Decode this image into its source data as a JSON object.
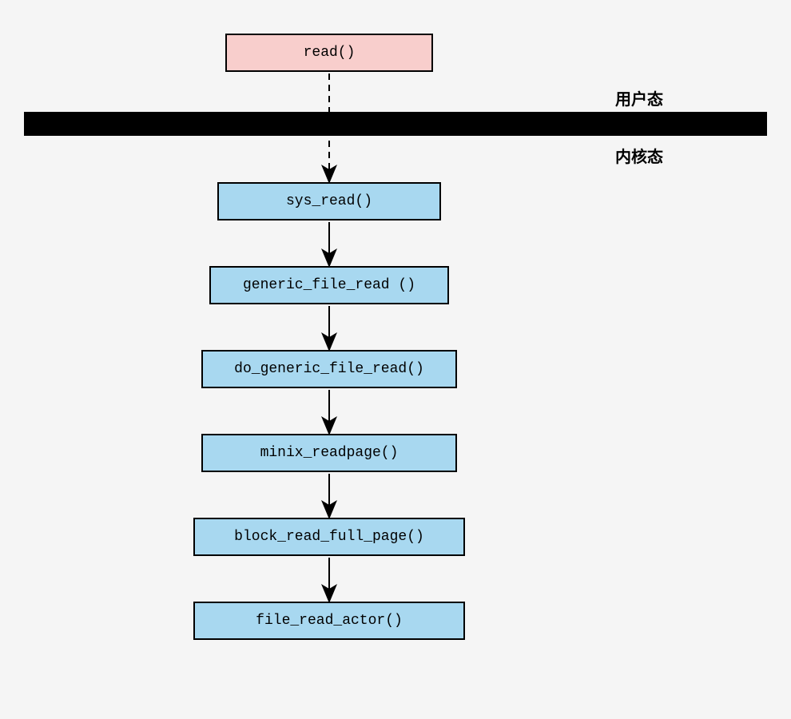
{
  "labels": {
    "user_mode": "用户态",
    "kernel_mode": "内核态"
  },
  "nodes": {
    "read": "read()",
    "sys_read": "sys_read()",
    "generic_file_read": "generic_file_read ()",
    "do_generic_file_read": "do_generic_file_read()",
    "minix_readpage": "minix_readpage()",
    "block_read_full_page": "block_read_full_page()",
    "file_read_actor": "file_read_actor()"
  },
  "chart_data": {
    "type": "flowchart",
    "title": "",
    "divider": {
      "above_label": "用户态",
      "below_label": "内核态"
    },
    "nodes": [
      {
        "id": "read",
        "label": "read()",
        "color": "pink",
        "zone": "user"
      },
      {
        "id": "sys_read",
        "label": "sys_read()",
        "color": "blue",
        "zone": "kernel"
      },
      {
        "id": "generic_file_read",
        "label": "generic_file_read ()",
        "color": "blue",
        "zone": "kernel"
      },
      {
        "id": "do_generic_file_read",
        "label": "do_generic_file_read()",
        "color": "blue",
        "zone": "kernel"
      },
      {
        "id": "minix_readpage",
        "label": "minix_readpage()",
        "color": "blue",
        "zone": "kernel"
      },
      {
        "id": "block_read_full_page",
        "label": "block_read_full_page()",
        "color": "blue",
        "zone": "kernel"
      },
      {
        "id": "file_read_actor",
        "label": "file_read_actor()",
        "color": "blue",
        "zone": "kernel"
      }
    ],
    "edges": [
      {
        "from": "read",
        "to": "sys_read",
        "style": "dashed"
      },
      {
        "from": "sys_read",
        "to": "generic_file_read",
        "style": "solid"
      },
      {
        "from": "generic_file_read",
        "to": "do_generic_file_read",
        "style": "solid"
      },
      {
        "from": "do_generic_file_read",
        "to": "minix_readpage",
        "style": "solid"
      },
      {
        "from": "minix_readpage",
        "to": "block_read_full_page",
        "style": "solid"
      },
      {
        "from": "block_read_full_page",
        "to": "file_read_actor",
        "style": "solid"
      }
    ]
  }
}
